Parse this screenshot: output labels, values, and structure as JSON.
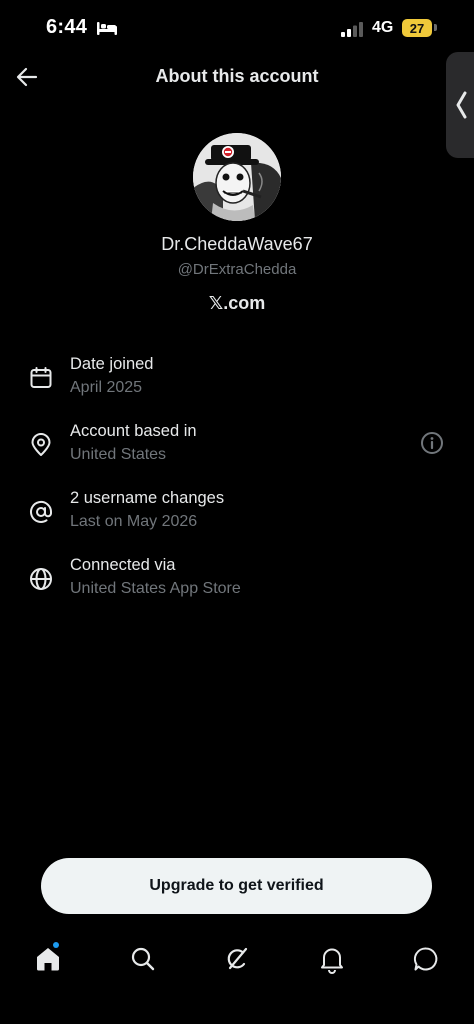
{
  "status_bar": {
    "time": "6:44",
    "network": "4G",
    "battery": "27",
    "icons": [
      "bed-icon",
      "signal-icon"
    ],
    "battery_color": "#f0c93a"
  },
  "header": {
    "title": "About this account",
    "back_icon": "arrow-left-icon",
    "side_handle_icon": "chevron-left-icon"
  },
  "profile": {
    "display_name": "Dr.CheddaWave67",
    "handle": "@DrExtraChedda",
    "site_mark": "𝕏",
    "site_suffix": ".com"
  },
  "details": [
    {
      "icon": "calendar-icon",
      "title": "Date joined",
      "subtitle": "April 2025"
    },
    {
      "icon": "location-pin-icon",
      "title": "Account based in",
      "subtitle": "United States",
      "trailing_icon": "info-icon"
    },
    {
      "icon": "at-sign-icon",
      "title": "2 username changes",
      "subtitle": "Last on May 2026"
    },
    {
      "icon": "globe-icon",
      "title": "Connected via",
      "subtitle": "United States App Store"
    }
  ],
  "cta": {
    "label": "Upgrade to get verified"
  },
  "bottom_nav": [
    {
      "icon": "home-icon",
      "active": true,
      "has_dot": true
    },
    {
      "icon": "search-icon"
    },
    {
      "icon": "grok-icon"
    },
    {
      "icon": "bell-icon"
    },
    {
      "icon": "chat-icon"
    }
  ],
  "colors": {
    "background": "#000000",
    "primary_text": "#e7e9ea",
    "secondary_text": "#71767b",
    "accent_dot": "#1d9bf0",
    "button_bg": "#eff3f4"
  }
}
